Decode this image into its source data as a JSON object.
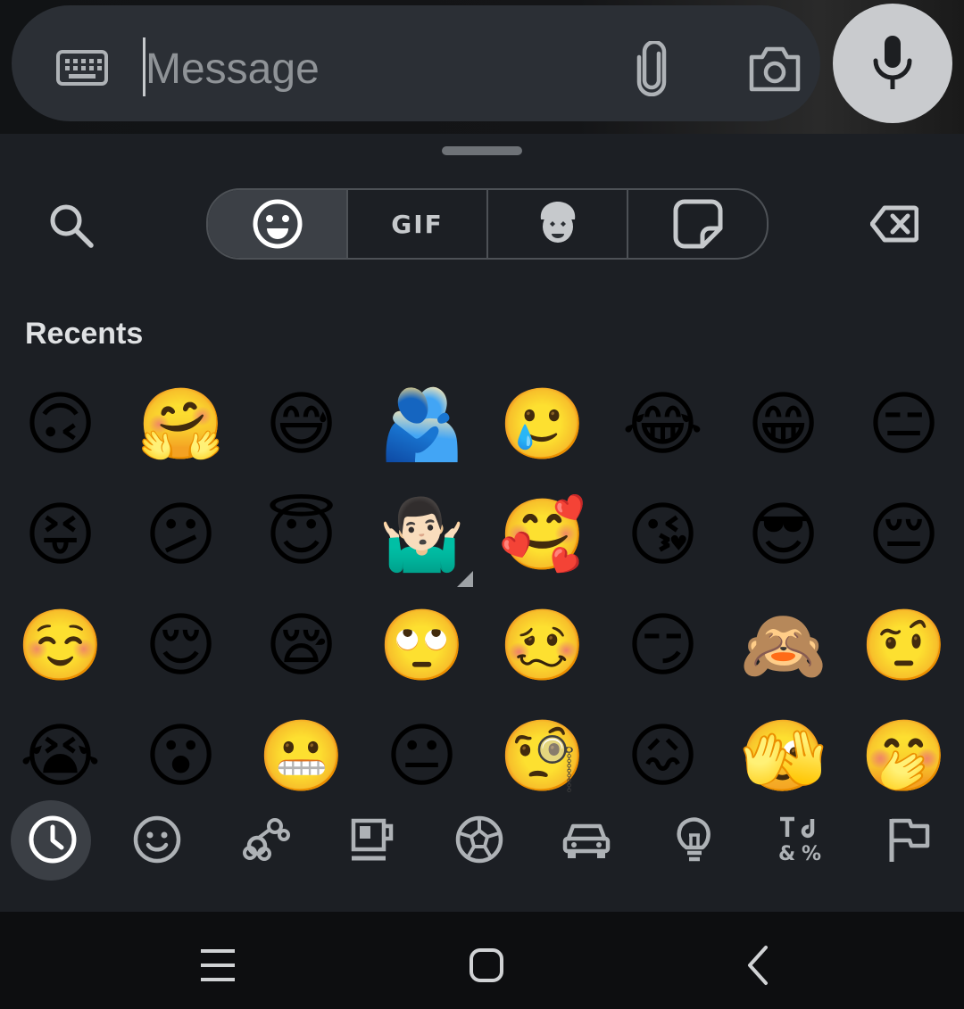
{
  "message_bar": {
    "placeholder": "Message",
    "icons": [
      "keyboard-icon",
      "paperclip-icon",
      "camera-icon",
      "microphone-icon"
    ]
  },
  "emoji_panel": {
    "tabs": [
      {
        "name": "emoji",
        "icon": "smiley-icon",
        "active": true
      },
      {
        "name": "gif",
        "label": "GIF"
      },
      {
        "name": "avatar",
        "icon": "avatar-sticker-icon"
      },
      {
        "name": "sticker",
        "icon": "sticker-icon"
      }
    ],
    "section_title": "Recents",
    "emoji_rows": [
      [
        "🙃",
        "🤗",
        "😅",
        "🫂",
        "🥲",
        "😂",
        "😁",
        "😑"
      ],
      [
        "😝",
        "😕",
        "😇",
        "🤷🏻‍♂️",
        "🥰",
        "😘",
        "😎",
        "😔"
      ],
      [
        "☺️",
        "😌",
        "😪",
        "🙄",
        "🥴",
        "😏",
        "🙈",
        "🤨"
      ],
      [
        "😭",
        "😮",
        "😬",
        "😐",
        "🧐",
        "😖",
        "🫣",
        "🤭"
      ]
    ],
    "categories": [
      {
        "name": "recents",
        "icon": "clock-icon",
        "active": true
      },
      {
        "name": "smileys",
        "icon": "smiley-icon"
      },
      {
        "name": "animals-nature",
        "icon": "flower-icon"
      },
      {
        "name": "food-drink",
        "icon": "coffee-icon"
      },
      {
        "name": "activities",
        "icon": "soccer-ball-icon"
      },
      {
        "name": "travel-places",
        "icon": "car-icon"
      },
      {
        "name": "objects",
        "icon": "lightbulb-icon"
      },
      {
        "name": "symbols",
        "icon": "symbols-icon"
      },
      {
        "name": "flags",
        "icon": "flag-icon"
      }
    ]
  },
  "nav_bar": {
    "buttons": [
      "recent-apps-icon",
      "home-icon",
      "back-icon"
    ]
  },
  "colors": {
    "panel_bg": "#1c1f24",
    "message_bar_bg": "#2b2f35",
    "mic_button_bg": "#c9cbce",
    "icon_color": "#c6c9cc",
    "active_tab_bg": "#3c4046"
  }
}
